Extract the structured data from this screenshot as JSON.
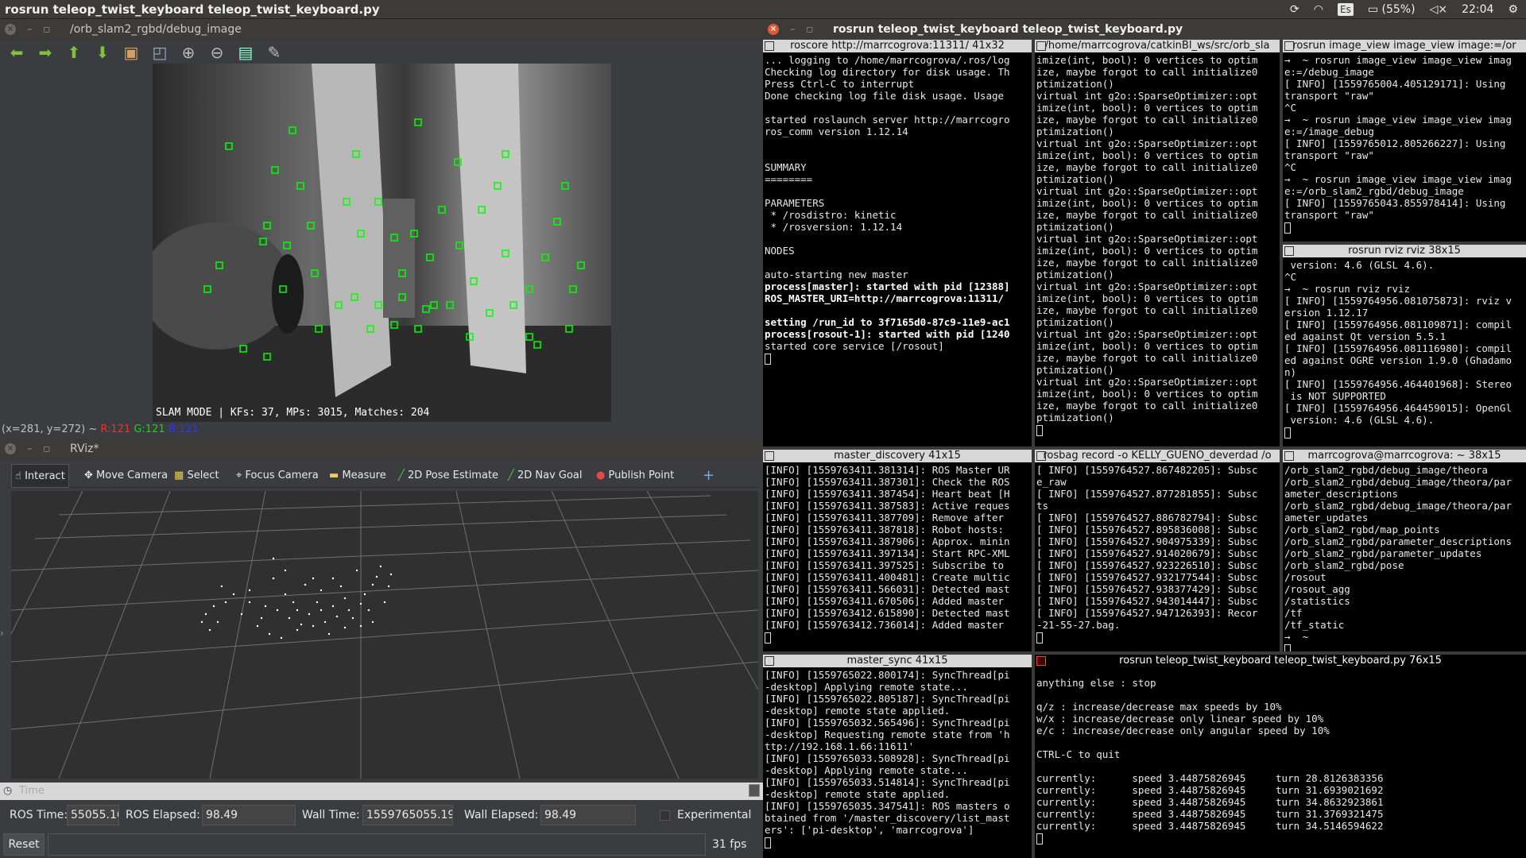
{
  "topbar": {
    "title": "rosrun teleop_twist_keyboard teleop_twist_keyboard.py",
    "kb": "Es",
    "battery": "(55%)",
    "time": "22:04"
  },
  "image_view": {
    "title": "/orb_slam2_rgbd/debug_image",
    "overlay": "SLAM MODE |  KFs: 37, MPs: 3015, Matches: 204",
    "coord": "(x=281, y=272) ~",
    "r": "R:121",
    "g": "G:121",
    "b": "B:121"
  },
  "rviz": {
    "title": "RViz*",
    "tools": [
      "Interact",
      "Move Camera",
      "Select",
      "Focus Camera",
      "Measure",
      "2D Pose Estimate",
      "2D Nav Goal",
      "Publish Point"
    ],
    "add": "+",
    "time_header": "Time",
    "ros_time_label": "ROS Time:",
    "ros_time": "55055.16",
    "ros_elapsed_label": "ROS Elapsed:",
    "ros_elapsed": "98.49",
    "wall_time_label": "Wall Time:",
    "wall_time": "1559765055.19",
    "wall_elapsed_label": "Wall Elapsed:",
    "wall_elapsed": "98.49",
    "experimental": "Experimental",
    "reset": "Reset",
    "fps": "31 fps"
  },
  "term_window": {
    "title": "rosrun teleop_twist_keyboard teleop_twist_keyboard.py"
  },
  "t1": {
    "title": "roscore http://marrcogrova:11311/ 41x32",
    "lines": [
      "... logging to /home/marrcogrova/.ros/log",
      "Checking log directory for disk usage. Th",
      "Press Ctrl-C to interrupt",
      "Done checking log file disk usage. Usage",
      "",
      "started roslaunch server http://marrcogro",
      "ros_comm version 1.12.14",
      "",
      "",
      "SUMMARY",
      "========",
      "",
      "PARAMETERS",
      " * /rosdistro: kinetic",
      " * /rosversion: 1.12.14",
      "",
      "NODES",
      "",
      "auto-starting new master",
      "process[master]: started with pid [12388]",
      "ROS_MASTER_URI=http://marrcogrova:11311/",
      "",
      "setting /run_id to 3f7165d0-87c9-11e9-ac1",
      "process[rosout-1]: started with pid [1240",
      "started core service [/rosout]"
    ]
  },
  "t2": {
    "title": "/home/marrcogrova/catkinBl_ws/src/orb_sla",
    "lines": [
      "imize(int, bool): 0 vertices to optim",
      "ize, maybe forgot to call initialize0",
      "ptimization()",
      "virtual int g2o::SparseOptimizer::opt",
      "imize(int, bool): 0 vertices to optim",
      "ize, maybe forgot to call initialize0",
      "ptimization()",
      "virtual int g2o::SparseOptimizer::opt",
      "imize(int, bool): 0 vertices to optim",
      "ize, maybe forgot to call initialize0",
      "ptimization()",
      "virtual int g2o::SparseOptimizer::opt",
      "imize(int, bool): 0 vertices to optim",
      "ize, maybe forgot to call initialize0",
      "ptimization()",
      "virtual int g2o::SparseOptimizer::opt",
      "imize(int, bool): 0 vertices to optim",
      "ize, maybe forgot to call initialize0",
      "ptimization()",
      "virtual int g2o::SparseOptimizer::opt",
      "imize(int, bool): 0 vertices to optim",
      "ize, maybe forgot to call initialize0",
      "ptimization()",
      "virtual int g2o::SparseOptimizer::opt",
      "imize(int, bool): 0 vertices to optim",
      "ize, maybe forgot to call initialize0",
      "ptimization()",
      "virtual int g2o::SparseOptimizer::opt",
      "imize(int, bool): 0 vertices to optim",
      "ize, maybe forgot to call initialize0",
      "ptimization()"
    ]
  },
  "t3": {
    "title": "rosrun image_view image_view image:=/or",
    "lines": [
      "→  ~ rosrun image_view image_view imag",
      "e:=/debug_image",
      "[ INFO] [1559765004.405129171]: Using",
      "transport \"raw\"",
      "^C",
      "→  ~ rosrun image_view image_view imag",
      "e:=/image_debug",
      "[ INFO] [1559765012.805266227]: Using",
      "transport \"raw\"",
      "^C",
      "→  ~ rosrun image_view image_view imag",
      "e:=/orb_slam2_rgbd/debug_image",
      "[ INFO] [1559765043.855978414]: Using",
      "transport \"raw\""
    ]
  },
  "t4": {
    "title": "rosrun rviz rviz 38x15",
    "lines": [
      " version: 4.6 (GLSL 4.6).",
      "^C",
      "→  ~ rosrun rviz rviz",
      "[ INFO] [1559764956.081075873]: rviz v",
      "ersion 1.12.17",
      "[ INFO] [1559764956.081109871]: compil",
      "ed against Qt version 5.5.1",
      "[ INFO] [1559764956.081116980]: compil",
      "ed against OGRE version 1.9.0 (Ghadamo",
      "n)",
      "[ INFO] [1559764956.464401968]: Stereo",
      " is NOT SUPPORTED",
      "[ INFO] [1559764956.464459015]: OpenGl",
      " version: 4.6 (GLSL 4.6)."
    ]
  },
  "t5": {
    "title": "master_discovery 41x15",
    "lines": [
      "[INFO] [1559763411.381314]: ROS Master UR",
      "[INFO] [1559763411.387301]: Check the ROS",
      "[INFO] [1559763411.387454]: Heart beat [H",
      "[INFO] [1559763411.387583]: Active reques",
      "[INFO] [1559763411.387709]: Remove after",
      "[INFO] [1559763411.387818]: Robot hosts:",
      "[INFO] [1559763411.387906]: Approx. minin",
      "[INFO] [1559763411.397134]: Start RPC-XML",
      "[INFO] [1559763411.397525]: Subscribe to",
      "[INFO] [1559763411.400481]: Create multic",
      "[INFO] [1559763411.566031]: Detected mast",
      "[INFO] [1559763411.670506]: Added master",
      "[INFO] [1559763412.615890]: Detected mast",
      "[INFO] [1559763412.736014]: Added master"
    ]
  },
  "t6": {
    "title": "rosbag record -o KELLY_GUENO_deverdad /o",
    "lines": [
      "[ INFO] [1559764527.867482205]: Subsc",
      "e_raw",
      "[ INFO] [1559764527.877281855]: Subsc",
      "ts",
      "[ INFO] [1559764527.886782794]: Subsc",
      "[ INFO] [1559764527.895836008]: Subsc",
      "[ INFO] [1559764527.904975339]: Subsc",
      "[ INFO] [1559764527.914020679]: Subsc",
      "[ INFO] [1559764527.923226510]: Subsc",
      "[ INFO] [1559764527.932177544]: Subsc",
      "[ INFO] [1559764527.938377429]: Subsc",
      "[ INFO] [1559764527.943014447]: Subsc",
      "[ INFO] [1559764527.947126393]: Recor",
      "-21-55-27.bag."
    ]
  },
  "t7": {
    "title": "marrcogrova@marrcogrova: ~ 38x15",
    "lines": [
      "/orb_slam2_rgbd/debug_image/theora",
      "/orb_slam2_rgbd/debug_image/theora/par",
      "ameter_descriptions",
      "/orb_slam2_rgbd/debug_image/theora/par",
      "ameter_updates",
      "/orb_slam2_rgbd/map_points",
      "/orb_slam2_rgbd/parameter_descriptions",
      "/orb_slam2_rgbd/parameter_updates",
      "/orb_slam2_rgbd/pose",
      "/rosout",
      "/rosout_agg",
      "/statistics",
      "/tf",
      "/tf_static",
      "→  ~ "
    ]
  },
  "t8": {
    "title": "master_sync 41x15",
    "lines": [
      "[INFO] [1559765022.800174]: SyncThread[pi",
      "-desktop] Applying remote state...",
      "[INFO] [1559765022.805187]: SyncThread[pi",
      "-desktop] remote state applied.",
      "[INFO] [1559765032.565496]: SyncThread[pi",
      "-desktop] Requesting remote state from 'h",
      "ttp://192.168.1.66:11611'",
      "[INFO] [1559765033.508928]: SyncThread[pi",
      "-desktop] Applying remote state...",
      "[INFO] [1559765033.514814]: SyncThread[pi",
      "-desktop] remote state applied.",
      "[INFO] [1559765035.347541]: ROS masters o",
      "btained from '/master_discovery/list_mast",
      "ers': ['pi-desktop', 'marrcogrova']"
    ]
  },
  "t9": {
    "title": "rosrun teleop_twist_keyboard teleop_twist_keyboard.py 76x15",
    "lines": [
      "anything else : stop",
      "",
      "q/z : increase/decrease max speeds by 10%",
      "w/x : increase/decrease only linear speed by 10%",
      "e/c : increase/decrease only angular speed by 10%",
      "",
      "CTRL-C to quit",
      "",
      "currently:      speed 3.44875826945     turn 28.8126383356",
      "currently:      speed 3.44875826945     turn 31.6939021692",
      "currently:      speed 3.44875826945     turn 34.8632923861",
      "currently:      speed 3.44875826945     turn 31.3769321475",
      "currently:      speed 3.44875826945     turn 34.5146594622"
    ]
  }
}
